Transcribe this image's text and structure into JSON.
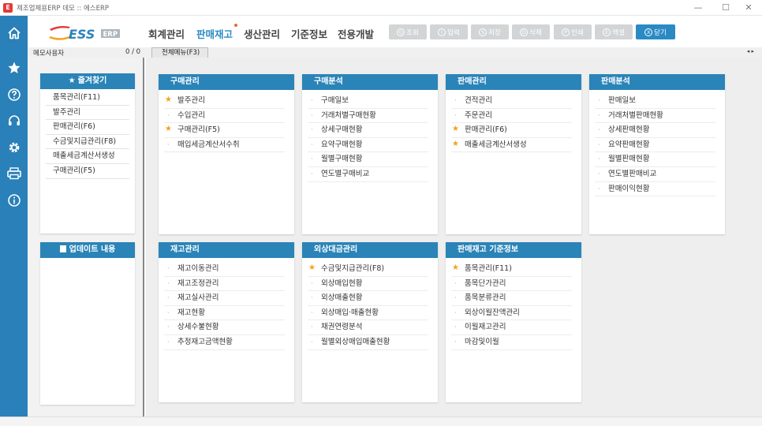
{
  "window": {
    "title": "제조업체용ERP 데모 :: 에스ERP",
    "app_icon_glyph": "E",
    "controls": {
      "minimize": "—",
      "maximize": "☐",
      "close": "✕"
    }
  },
  "sidebar": {
    "icons": [
      "home-icon",
      "star-icon",
      "help-icon",
      "headset-icon",
      "gear-icon",
      "printer-icon",
      "info-icon"
    ]
  },
  "logo": {
    "text": "ESS",
    "badge": "ERP",
    "color": "#2a84b8",
    "accent": "#e5383b"
  },
  "menu": {
    "items": [
      "회계관리",
      "판매재고",
      "생산관리",
      "기준정보",
      "전용개발"
    ],
    "active": "판매재고"
  },
  "toolbar": {
    "search": {
      "icon": "Q",
      "label": "조회"
    },
    "input": {
      "icon": "I",
      "label": "입력"
    },
    "save": {
      "icon": "S",
      "label": "저장"
    },
    "delete": {
      "icon": "D",
      "label": "삭제"
    },
    "print": {
      "icon": "P",
      "label": "인쇄"
    },
    "excel": {
      "icon": "E",
      "label": "엑셀"
    },
    "close": {
      "icon": "X",
      "label": "닫기"
    }
  },
  "tabbar": {
    "memo_label": "메모사용자",
    "memo_count": "0 / 0",
    "tab": "전체메뉴(F3)",
    "arrows": "◂ ▸"
  },
  "favorites": {
    "title": "즐겨찾기",
    "items": [
      "품목관리(F11)",
      "발주관리",
      "판매관리(F6)",
      "수금및지급관리(F8)",
      "매출세금계산서생성",
      "구매관리(F5)"
    ]
  },
  "updates": {
    "title": "업데이트 내용"
  },
  "cards": {
    "c1": {
      "title": "구매관리",
      "items": [
        {
          "label": "발주관리",
          "star": true
        },
        {
          "label": "수입관리",
          "star": false
        },
        {
          "label": "구매관리(F5)",
          "star": true
        },
        {
          "label": "매입세금계산서수취",
          "star": false
        }
      ]
    },
    "c2": {
      "title": "구매분석",
      "items": [
        {
          "label": "구매일보",
          "star": false
        },
        {
          "label": "거래처별구매현황",
          "star": false
        },
        {
          "label": "상세구매현황",
          "star": false
        },
        {
          "label": "요약구매현황",
          "star": false
        },
        {
          "label": "월별구매현황",
          "star": false
        },
        {
          "label": "연도별구매비교",
          "star": false
        }
      ]
    },
    "c3": {
      "title": "판매관리",
      "items": [
        {
          "label": "견적관리",
          "star": false
        },
        {
          "label": "주문관리",
          "star": false
        },
        {
          "label": "판매관리(F6)",
          "star": true
        },
        {
          "label": "매출세금계산서생성",
          "star": true
        }
      ]
    },
    "c4": {
      "title": "판매분석",
      "items": [
        {
          "label": "판매일보",
          "star": false
        },
        {
          "label": "거래처별판매현황",
          "star": false
        },
        {
          "label": "상세판매현황",
          "star": false
        },
        {
          "label": "요약판매현황",
          "star": false
        },
        {
          "label": "월별판매현황",
          "star": false
        },
        {
          "label": "연도별판매비교",
          "star": false
        },
        {
          "label": "판매이익현황",
          "star": false
        }
      ]
    },
    "c5": {
      "title": "재고관리",
      "items": [
        {
          "label": "재고이동관리",
          "star": false
        },
        {
          "label": "재고조정관리",
          "star": false
        },
        {
          "label": "재고실사관리",
          "star": false
        },
        {
          "label": "재고현황",
          "star": false
        },
        {
          "label": "상세수불현황",
          "star": false
        },
        {
          "label": "추정재고금액현황",
          "star": false
        }
      ]
    },
    "c6": {
      "title": "외상대금관리",
      "items": [
        {
          "label": "수금및지급관리(F8)",
          "star": true
        },
        {
          "label": "외상매입현황",
          "star": false
        },
        {
          "label": "외상매출현황",
          "star": false
        },
        {
          "label": "외상매입·매출현황",
          "star": false
        },
        {
          "label": "채권연령분석",
          "star": false
        },
        {
          "label": "월별외상매입매출현황",
          "star": false
        }
      ]
    },
    "c7": {
      "title": "판매재고 기준정보",
      "items": [
        {
          "label": "품목관리(F11)",
          "star": true
        },
        {
          "label": "품목단가관리",
          "star": false
        },
        {
          "label": "품목분류관리",
          "star": false
        },
        {
          "label": "외상이월잔액관리",
          "star": false
        },
        {
          "label": "이월재고관리",
          "star": false
        },
        {
          "label": "마감및이월",
          "star": false
        }
      ]
    }
  }
}
